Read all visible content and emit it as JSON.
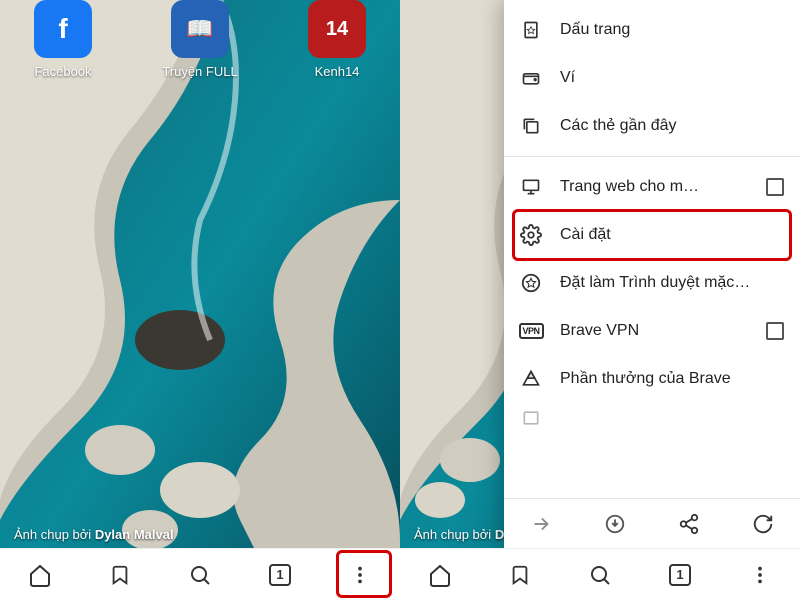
{
  "apps": [
    {
      "name": "Facebook",
      "badge": "f"
    },
    {
      "name": "Truyện FULL",
      "badge": "📖"
    },
    {
      "name": "Kenh14",
      "badge": "14"
    }
  ],
  "caption_prefix": "Ảnh chụp bởi ",
  "caption_author": "Dylan Malval",
  "nav": {
    "tab_count": "1"
  },
  "menu": {
    "bookmarks": "Dấu trang",
    "wallet": "Ví",
    "recent_tabs": "Các thẻ gần đây",
    "desktop_site": "Trang web cho m…",
    "settings": "Cài đặt",
    "set_default": "Đặt làm Trình duyệt mặc…",
    "vpn": "Brave VPN",
    "vpn_badge": "VPN",
    "rewards": "Phần thưởng của Brave"
  }
}
